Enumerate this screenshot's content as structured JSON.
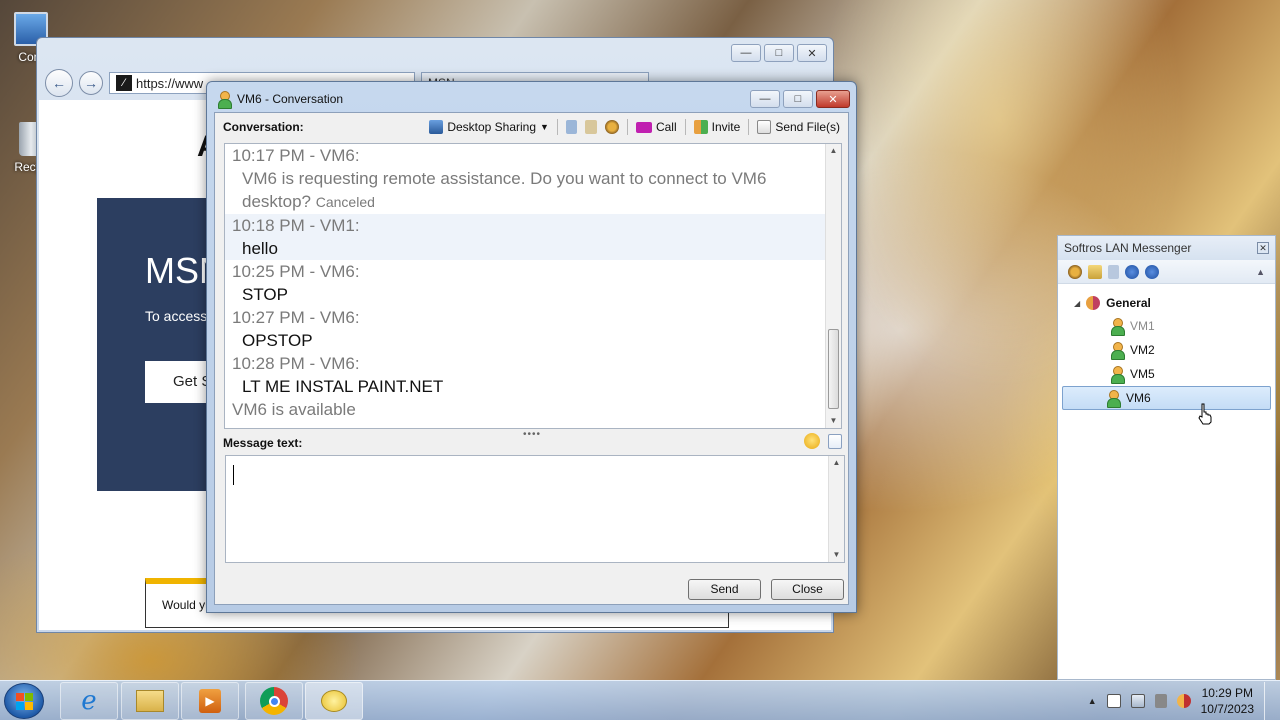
{
  "desktop": {
    "icons": [
      {
        "label": "Com",
        "icon": "computer-icon"
      },
      {
        "label": "Recyc",
        "icon": "recycle-bin-icon"
      }
    ]
  },
  "browser": {
    "address": "https://www",
    "tab_title": "MSN",
    "hero_title": "MSN",
    "hero_subtitle": "To access l",
    "hero_button": "Get S",
    "big_letter": "A",
    "cookie_text": "Would y"
  },
  "conversation": {
    "window_title": "VM6 - Conversation",
    "label": "Conversation:",
    "toolbar": {
      "desktop_sharing": "Desktop Sharing",
      "call": "Call",
      "invite": "Invite",
      "send_files": "Send File(s)"
    },
    "messages": [
      {
        "header": "10:17 PM - VM6:",
        "text": "VM6 is requesting remote assistance. Do you want to connect to VM6 desktop?",
        "note": "Canceled",
        "system": true
      },
      {
        "header": "10:18 PM - VM1:",
        "text": "hello",
        "note": "",
        "system": false
      },
      {
        "header": "10:25 PM - VM6:",
        "text": "STOP",
        "note": "",
        "system": false
      },
      {
        "header": "10:27 PM - VM6:",
        "text": "OPSTOP",
        "note": "",
        "system": false
      },
      {
        "header": "10:28 PM - VM6:",
        "text": "LT ME INSTAL PAINT.NET",
        "note": "",
        "system": false
      }
    ],
    "status_line": "VM6 is available",
    "message_label": "Message text:",
    "message_value": "",
    "send_label": "Send",
    "close_label": "Close"
  },
  "softros": {
    "title": "Softros LAN Messenger",
    "group": "General",
    "users": [
      {
        "name": "VM1",
        "online": false,
        "selected": false
      },
      {
        "name": "VM2",
        "online": true,
        "selected": false
      },
      {
        "name": "VM5",
        "online": true,
        "selected": false
      },
      {
        "name": "VM6",
        "online": true,
        "selected": true
      }
    ]
  },
  "taskbar": {
    "time": "10:29 PM",
    "date": "10/7/2023"
  }
}
